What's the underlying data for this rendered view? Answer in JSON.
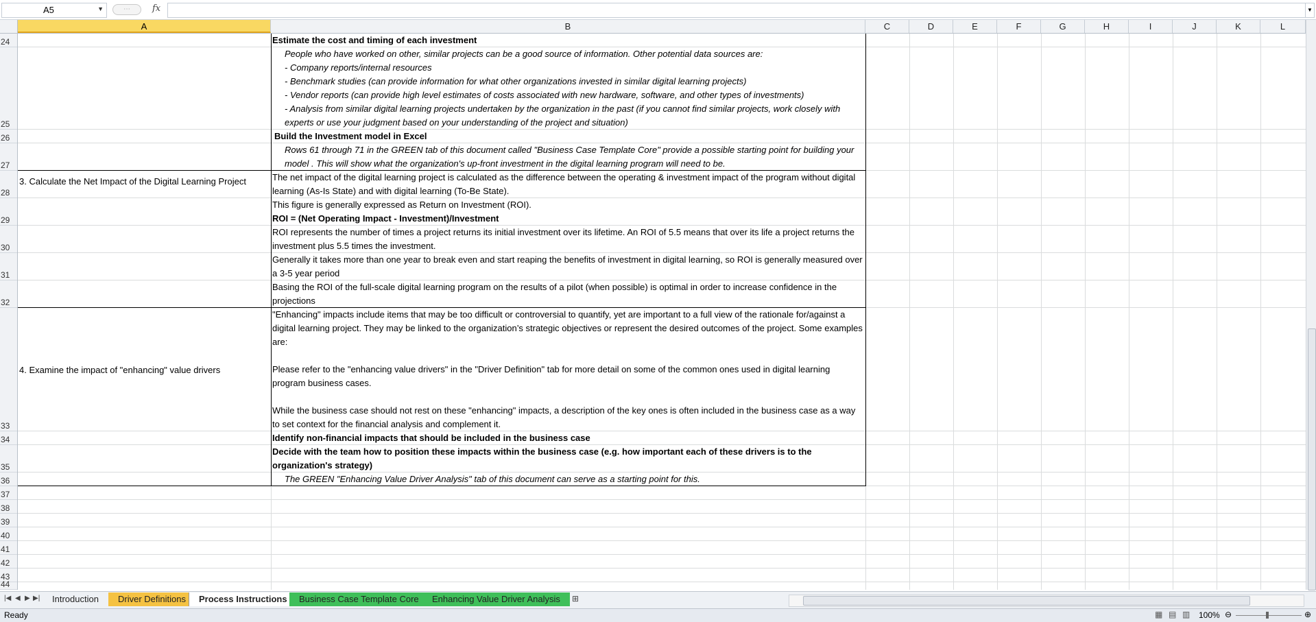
{
  "formula_bar": {
    "name_box": "A5",
    "fx_label": "fx",
    "formula": ""
  },
  "columns": [
    "A",
    "B",
    "C",
    "D",
    "E",
    "F",
    "G",
    "H",
    "I",
    "J",
    "K",
    "L"
  ],
  "rows": [
    "24",
    "25",
    "26",
    "27",
    "28",
    "29",
    "30",
    "31",
    "32",
    "33",
    "34",
    "35",
    "36",
    "37",
    "38",
    "39",
    "40",
    "41",
    "42",
    "43",
    "44"
  ],
  "cells": {
    "b24": "Estimate the cost and timing of each investment",
    "b25_1": "People who have worked on other, similar projects can be a good source of information. Other potential data sources are:",
    "b25_2": "- Company reports/internal resources",
    "b25_3": "- Benchmark studies (can provide information for what other organizations invested in similar digital learning projects)",
    "b25_4": "- Vendor reports (can provide high level estimates of costs associated with new hardware, software, and other types of investments)",
    "b25_5": "- Analysis from similar digital learning projects undertaken by the organization in the past (if you cannot find similar projects, work closely with experts or use your judgment based on your understanding of the project and situation)",
    "b26": "Build the Investment model in Excel",
    "b27": "Rows 61 through 71 in the GREEN tab of this document called \"Business Case Template Core\" provide a possible starting point for building your model . This will show what the organization's up-front investment in the digital learning program will need to be.",
    "a28": "3. Calculate the Net Impact of the Digital Learning Project",
    "b28": "The net impact of the digital learning project is calculated as the difference between the operating & investment impact of the program without digital learning (As-Is State) and with digital learning (To-Be State).",
    "b29_1": "This figure is generally expressed as Return on Investment (ROI).",
    "b29_2": "ROI = (Net Operating Impact - Investment)/Investment",
    "b30": "ROI represents the number of times a project returns its initial investment over its lifetime. An ROI of 5.5 means that over its life a project returns the investment plus 5.5 times the investment.",
    "b31": "Generally it takes more than one year to break even and start reaping the benefits of investment in digital learning, so ROI is generally measured over a 3-5 year period",
    "b32": "Basing the ROI of the full-scale digital learning program on the results of a pilot (when possible) is optimal in order to increase confidence in the projections",
    "a33": "4. Examine the impact of \"enhancing\" value drivers",
    "b33_1": "\"Enhancing\" impacts include items that may be too difficult or controversial to quantify, yet are important to a full view of the rationale for/against a digital learning project. They may be linked to the organization’s strategic objectives or represent the desired outcomes of the project. Some examples are:",
    "b33_2": "Please refer to the \"enhancing value drivers\" in the \"Driver Definition\" tab for more detail on some of the common ones used in digital learning program business cases.",
    "b33_3": "While the business case should not rest on these \"enhancing\" impacts, a description of the key ones is often included in the business case as a way to set context for the financial analysis and complement it.",
    "b34": "Identify non-financial impacts that should be included in the business case",
    "b35": "Decide with the team how to position these impacts within the business case (e.g. how important each of these drivers is to the organization's strategy)",
    "b36": "The GREEN \"Enhancing Value Driver Analysis\" tab of this document can serve as a starting point for this."
  },
  "sheet_tabs": [
    {
      "label": "Introduction",
      "color": "#eef1f5",
      "active": false
    },
    {
      "label": "Driver Definitions",
      "color": "#f5c242",
      "active": false
    },
    {
      "label": "Process Instructions",
      "color": "#ffffff",
      "active": true
    },
    {
      "label": "Business Case Template Core",
      "color": "#3fbf5a",
      "active": false
    },
    {
      "label": "Enhancing Value Driver Analysis",
      "color": "#3fbf5a",
      "active": false
    }
  ],
  "status_bar": {
    "status": "Ready",
    "zoom": "100%"
  }
}
